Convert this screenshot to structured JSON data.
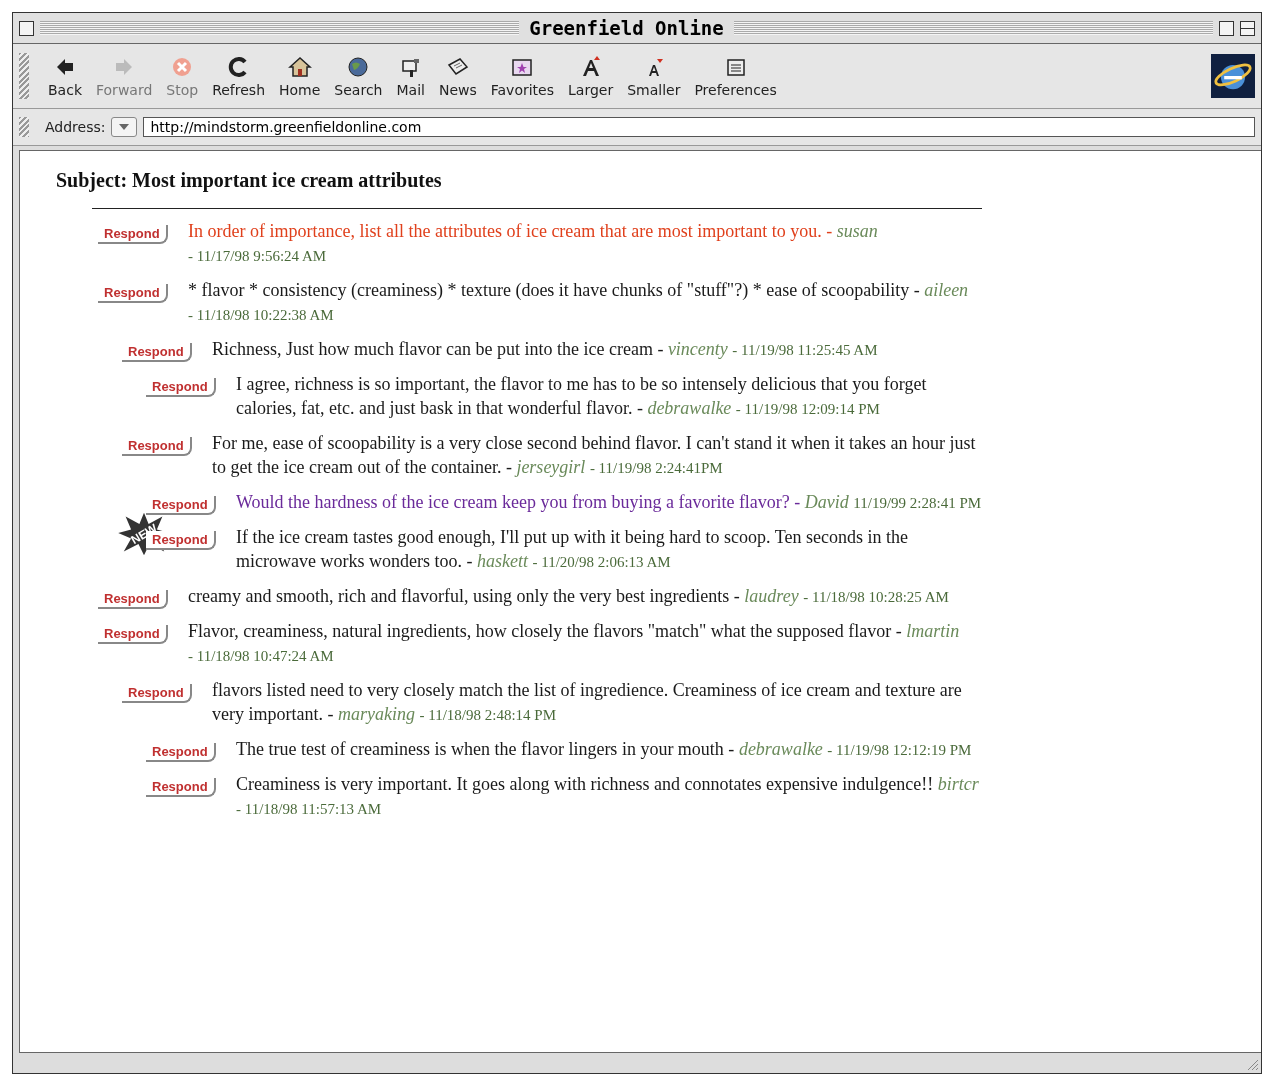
{
  "window": {
    "title": "Greenfield Online"
  },
  "toolbar": [
    {
      "label": "Back",
      "kind": "back",
      "disabled": false
    },
    {
      "label": "Forward",
      "kind": "forward",
      "disabled": true
    },
    {
      "label": "Stop",
      "kind": "stop",
      "disabled": true
    },
    {
      "label": "Refresh",
      "kind": "refresh",
      "disabled": false
    },
    {
      "label": "Home",
      "kind": "home",
      "disabled": false
    },
    {
      "label": "Search",
      "kind": "search",
      "disabled": false
    },
    {
      "label": "Mail",
      "kind": "mail",
      "disabled": false
    },
    {
      "label": "News",
      "kind": "news",
      "disabled": false
    },
    {
      "label": "Favorites",
      "kind": "favorites",
      "disabled": false
    },
    {
      "label": "Larger",
      "kind": "larger",
      "disabled": false
    },
    {
      "label": "Smaller",
      "kind": "smaller",
      "disabled": false
    },
    {
      "label": "Preferences",
      "kind": "preferences",
      "disabled": false
    }
  ],
  "address": {
    "label": "Address:",
    "value": "http://mindstorm.greenfieldonline.com"
  },
  "subject": "Subject: Most important ice cream attributes",
  "posts": [
    {
      "button": "Respond",
      "new": false,
      "color": "#e0401c",
      "text": "In order of importance, list all the attributes of ice cream that are most important to you. -",
      "author": "susan",
      "date": "- 11/17/98 9:56:24 AM"
    },
    {
      "button": "Respond",
      "new": false,
      "color": "#1a1a1a",
      "text": "* flavor * consistency (creaminess) * texture (does it have chunks of \"stuff\"?) * ease of scoopability -",
      "author": "aileen",
      "date": "- 11/18/98 10:22:38 AM",
      "children": [
        {
          "button": "Respond",
          "new": false,
          "color": "#1a1a1a",
          "text": "Richness, Just how much flavor can be put into the ice cream -",
          "author": "vincenty",
          "date": "- 11/19/98 11:25:45 AM",
          "children": [
            {
              "button": "Respond",
              "new": false,
              "color": "#1a1a1a",
              "text": "I agree, richness is so important, the flavor to me has to be so intensely delicious that you forget calories, fat, etc. and just bask in that wonderful flavor. -",
              "author": "debrawalke",
              "date": "- 11/19/98 12:09:14 PM"
            }
          ]
        },
        {
          "button": "Respond",
          "new": false,
          "color": "#1a1a1a",
          "text": "For me, ease of scoopability is a very close second behind flavor. I can't stand it when it takes an hour just to get the ice cream out of the container. -",
          "author": "jerseygirl",
          "date": "- 11/19/98 2:24:41PM",
          "children": [
            {
              "button": "Respond",
              "new": false,
              "color": "#6a2a9a",
              "text": "Would the hardness of the ice cream keep you from buying a favorite flavor? -",
              "author": "David",
              "date": "11/19/99 2:28:41 PM"
            },
            {
              "button": "Respond",
              "new": true,
              "badge": "NEW",
              "color": "#1a1a1a",
              "text": "If the ice cream tastes good enough, I'll put up with it being hard to scoop. Ten seconds in the microwave works wonders too. -",
              "author": "haskett",
              "date": "- 11/20/98 2:06:13 AM"
            }
          ]
        }
      ]
    },
    {
      "button": "Respond",
      "new": false,
      "color": "#1a1a1a",
      "text": "creamy and smooth, rich and flavorful, using only the very best ingredients -",
      "author": "laudrey",
      "date": "- 11/18/98 10:28:25 AM"
    },
    {
      "button": "Respond",
      "new": false,
      "color": "#1a1a1a",
      "text": "Flavor, creaminess, natural ingredients, how closely the flavors \"match\" what the supposed flavor -",
      "author": "lmartin",
      "date": "- 11/18/98 10:47:24 AM",
      "children": [
        {
          "button": "Respond",
          "new": false,
          "color": "#1a1a1a",
          "text": "flavors listed need to very closely match the list of ingredience. Creaminess of ice cream and texture are very important. -",
          "author": "maryaking",
          "date": "- 11/18/98 2:48:14 PM",
          "children": [
            {
              "button": "Respond",
              "new": false,
              "color": "#1a1a1a",
              "text": "The true test of creaminess is when the flavor lingers in your mouth -",
              "author": "debrawalke",
              "date": "- 11/19/98 12:12:19 PM"
            },
            {
              "button": "Respond",
              "new": false,
              "color": "#1a1a1a",
              "text": "Creaminess is very important. It goes along with richness and connotates expensive indulgence!!",
              "author": "birtcr",
              "date": "- 11/18/98 11:57:13 AM"
            }
          ]
        }
      ]
    }
  ]
}
